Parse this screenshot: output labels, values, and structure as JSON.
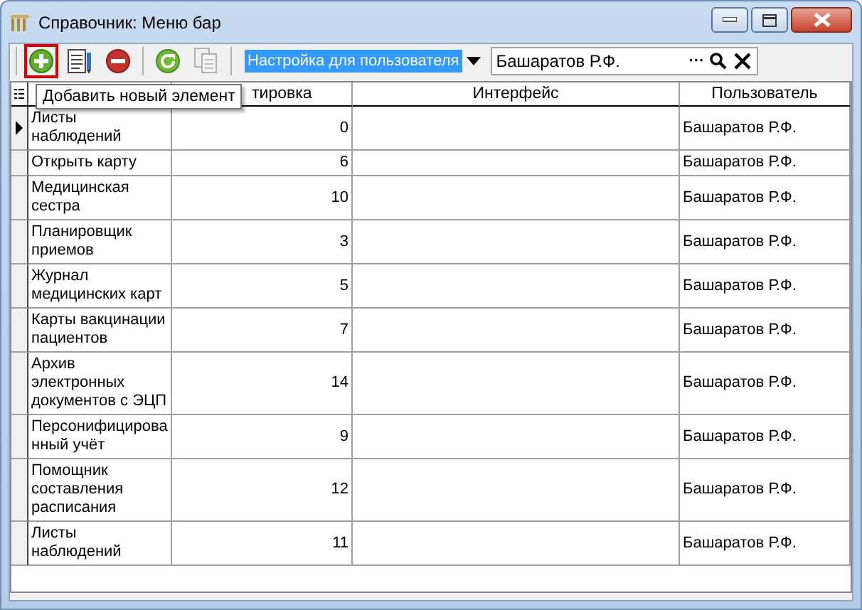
{
  "window": {
    "title": "Справочник: Меню бар"
  },
  "toolbar": {
    "buttons": [
      {
        "kind": "add",
        "highlighted": true,
        "disabled": false
      },
      {
        "kind": "edit",
        "highlighted": false,
        "disabled": false
      },
      {
        "kind": "delete",
        "highlighted": false,
        "disabled": false
      },
      {
        "kind": "refresh",
        "highlighted": false,
        "disabled": false
      },
      {
        "kind": "copy",
        "highlighted": false,
        "disabled": true
      }
    ],
    "mode_dropdown": {
      "value": "Настройка для пользователя"
    },
    "user_field": {
      "value": "Башаратов Р.Ф.",
      "browse": "···"
    }
  },
  "tooltip": "Добавить новый элемент",
  "table": {
    "columns": [
      {
        "label": "тировка"
      },
      {
        "label": "Интерфейс"
      },
      {
        "label": "Пользователь"
      }
    ],
    "rows": [
      {
        "name": "Листы\nнаблюдений",
        "order": "0",
        "user": "Башаратов Р.Ф.",
        "current": true
      },
      {
        "name": "Открыть карту",
        "order": "6",
        "user": "Башаратов Р.Ф.",
        "current": false
      },
      {
        "name": "Медицинская\nсестра",
        "order": "10",
        "user": "Башаратов Р.Ф.",
        "current": false
      },
      {
        "name": "Планировщик\nприемов",
        "order": "3",
        "user": "Башаратов Р.Ф.",
        "current": false
      },
      {
        "name": "Журнал\nмедицинских карт",
        "order": "5",
        "user": "Башаратов Р.Ф.",
        "current": false
      },
      {
        "name": "Карты вакцинации\nпациентов",
        "order": "7",
        "user": "Башаратов Р.Ф.",
        "current": false
      },
      {
        "name": "Архив\nэлектронных\nдокументов с ЭЦП",
        "order": "14",
        "user": "Башаратов Р.Ф.",
        "current": false
      },
      {
        "name": "Персонифицирова\nнный учёт",
        "order": "9",
        "user": "Башаратов Р.Ф.",
        "current": false
      },
      {
        "name": "Помощник\nсоставления\nрасписания",
        "order": "12",
        "user": "Башаратов Р.Ф.",
        "current": false
      },
      {
        "name": "Листы\nнаблюдений",
        "order": "11",
        "user": "Башаратов Р.Ф.",
        "current": false
      }
    ]
  }
}
